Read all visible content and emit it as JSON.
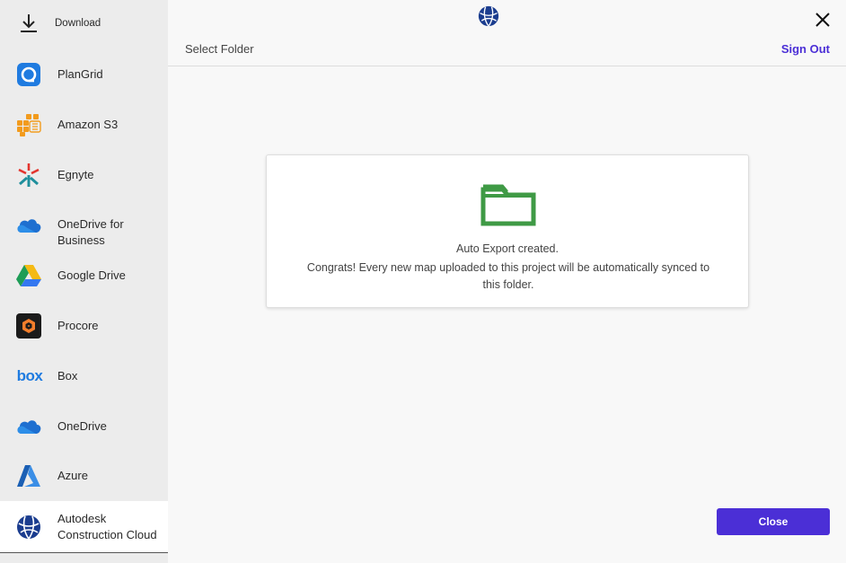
{
  "sidebar": {
    "items": [
      {
        "label": "Download",
        "icon": "download-icon"
      },
      {
        "label": "PlanGrid",
        "icon": "plangrid-icon"
      },
      {
        "label": "Amazon S3",
        "icon": "amazon-s3-icon"
      },
      {
        "label": "Egnyte",
        "icon": "egnyte-icon"
      },
      {
        "label": "OneDrive for Business",
        "icon": "onedrive-business-icon"
      },
      {
        "label": "Google Drive",
        "icon": "google-drive-icon"
      },
      {
        "label": "Procore",
        "icon": "procore-icon"
      },
      {
        "label": "Box",
        "icon": "box-icon"
      },
      {
        "label": "OneDrive",
        "icon": "onedrive-icon"
      },
      {
        "label": "Azure",
        "icon": "azure-icon"
      },
      {
        "label": "Autodesk Construction Cloud",
        "icon": "autodesk-icon"
      }
    ],
    "active_index": 10,
    "box_logo_text": "box"
  },
  "header": {
    "breadcrumb": "Select Folder",
    "sign_out": "Sign Out"
  },
  "card": {
    "title": "Auto Export created.",
    "message": "Congrats! Every new map uploaded to this project will be automatically synced to this folder."
  },
  "footer": {
    "close_label": "Close"
  },
  "colors": {
    "accent": "#4b2fd6",
    "folder": "#3f9a45",
    "sidebar_bg": "#ececec"
  }
}
